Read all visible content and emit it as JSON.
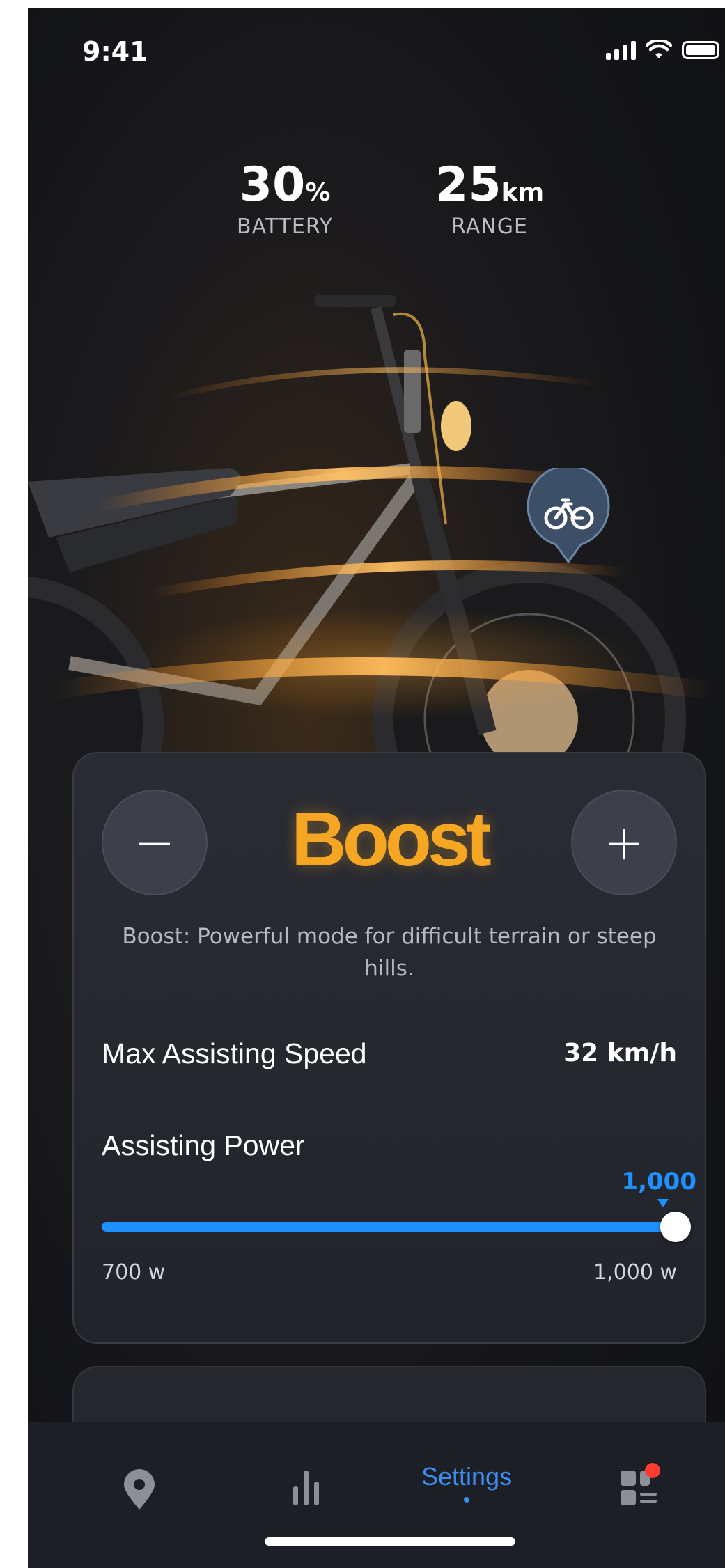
{
  "status_bar": {
    "time": "9:41"
  },
  "stats": {
    "battery": {
      "value": "30",
      "unit": "%",
      "label": "BATTERY"
    },
    "range": {
      "value": "25",
      "unit": "km",
      "label": "RANGE"
    }
  },
  "mode": {
    "title": "Boost",
    "description": "Boost: Powerful mode for difficult terrain or steep hills.",
    "decrease_symbol": "−",
    "increase_symbol": "+"
  },
  "max_speed": {
    "label": "Max Assisting Speed",
    "value": "32 km/h"
  },
  "assisting_power": {
    "label": "Assisting Power",
    "current": "1,000",
    "min_label": "700 w",
    "max_label": "1,000 w",
    "level_fraction": 1.0
  },
  "tabbar": {
    "items": [
      {
        "icon": "location-pin-icon"
      },
      {
        "icon": "bar-chart-icon"
      },
      {
        "label": "Settings",
        "active": true
      },
      {
        "icon": "apps-icon",
        "badge": true
      }
    ]
  },
  "colors": {
    "accent": "#f5a623",
    "slider": "#1e90ff",
    "tab_active": "#3d8ef0"
  }
}
